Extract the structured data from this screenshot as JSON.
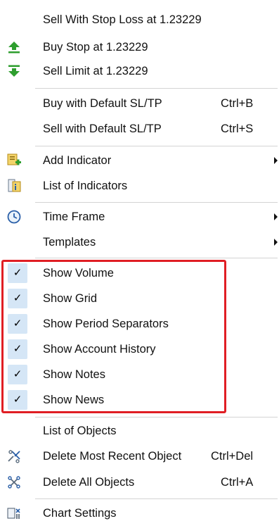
{
  "menu": {
    "items": [
      {
        "label": "Sell With Stop Loss at 1.23229"
      },
      {
        "label": "Buy Stop at 1.23229",
        "icon": "buy-stop-arrow-icon"
      },
      {
        "label": "Sell Limit at 1.23229",
        "icon": "sell-limit-arrow-icon"
      },
      {
        "label": "Buy with Default SL/TP",
        "shortcut": "Ctrl+B"
      },
      {
        "label": "Sell with Default SL/TP",
        "shortcut": "Ctrl+S"
      },
      {
        "label": "Add Indicator",
        "icon": "add-indicator-icon",
        "submenu": true
      },
      {
        "label": "List of Indicators",
        "icon": "list-indicators-icon"
      },
      {
        "label": "Time Frame",
        "icon": "clock-icon",
        "submenu": true
      },
      {
        "label": "Templates",
        "submenu": true
      },
      {
        "label": "Show Volume",
        "checked": true
      },
      {
        "label": "Show Grid",
        "checked": true
      },
      {
        "label": "Show Period Separators",
        "checked": true
      },
      {
        "label": "Show Account History",
        "checked": true
      },
      {
        "label": "Show Notes",
        "checked": true
      },
      {
        "label": "Show News",
        "checked": true
      },
      {
        "label": "List of Objects"
      },
      {
        "label": "Delete Most Recent Object",
        "shortcut": "Ctrl+Del",
        "icon": "delete-object-icon"
      },
      {
        "label": "Delete All Objects",
        "shortcut": "Ctrl+A",
        "icon": "delete-all-objects-icon"
      },
      {
        "label": "Chart Settings",
        "icon": "chart-settings-icon"
      }
    ]
  },
  "check_glyph": "✓",
  "colors": {
    "highlight_border": "#e01e24",
    "checkbox_bg": "#d5e6f6",
    "buy_green": "#2e9e2e",
    "separator": "#d4d4d4"
  }
}
